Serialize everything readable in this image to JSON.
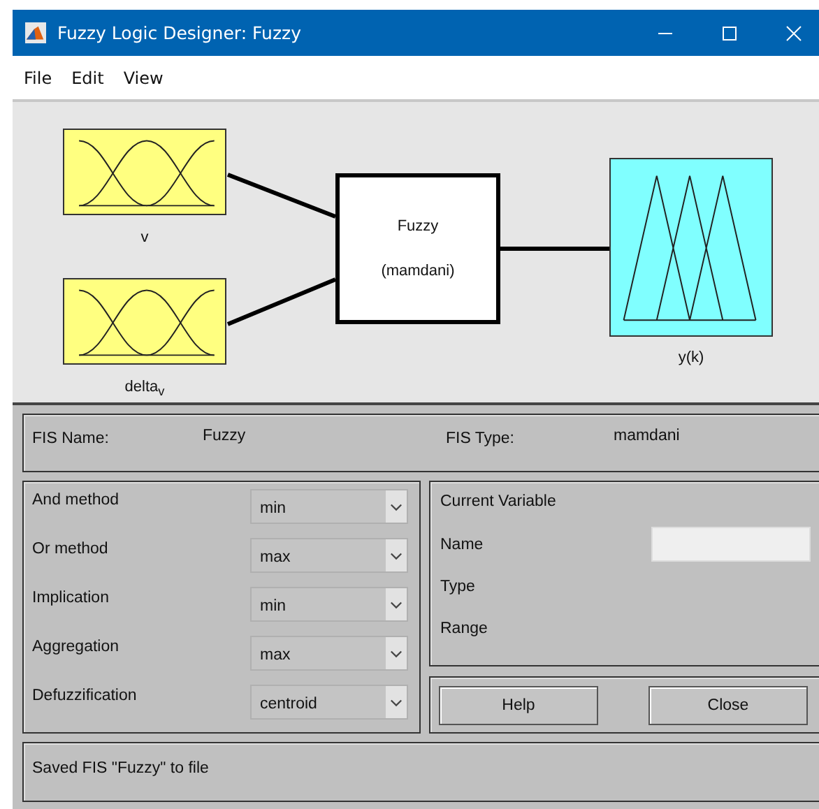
{
  "window": {
    "title": "Fuzzy Logic Designer: Fuzzy"
  },
  "menu": [
    {
      "label": "File"
    },
    {
      "label": "Edit"
    },
    {
      "label": "View"
    }
  ],
  "diagram": {
    "inputs": [
      {
        "name": "v"
      },
      {
        "name": "delta$_{v}$"
      }
    ],
    "system": {
      "name": "Fuzzy",
      "type": "(mamdani)"
    },
    "outputs": [
      {
        "name": "y(k)"
      }
    ]
  },
  "fis_info": [
    {
      "label": "FIS Name:",
      "value": "Fuzzy"
    },
    {
      "label": "FIS Type:",
      "value": "mamdani"
    }
  ],
  "methods": [
    {
      "label": "And method",
      "value": "min"
    },
    {
      "label": "Or method",
      "value": "max"
    },
    {
      "label": "Implication",
      "value": "min"
    },
    {
      "label": "Aggregation",
      "value": "max"
    },
    {
      "label": "Defuzzification",
      "value": "centroid"
    }
  ],
  "current_variable": {
    "title": "Current Variable",
    "fields": [
      {
        "label": "Name",
        "kind": "input"
      },
      {
        "label": "Type",
        "kind": "text"
      },
      {
        "label": "Range",
        "kind": "text"
      }
    ]
  },
  "buttons": [
    {
      "label": "Help"
    },
    {
      "label": "Close"
    }
  ],
  "status": "Saved FIS \"Fuzzy\" to file"
}
